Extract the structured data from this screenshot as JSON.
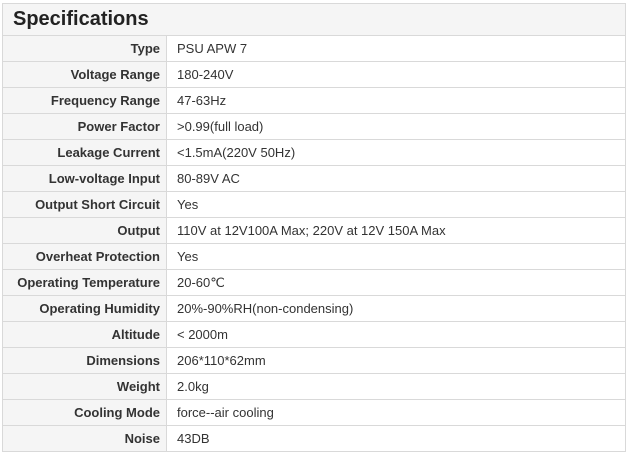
{
  "title": "Specifications",
  "rows": [
    {
      "label": "Type",
      "value": "PSU APW 7"
    },
    {
      "label": "Voltage Range",
      "value": "180-240V"
    },
    {
      "label": "Frequency Range",
      "value": "47-63Hz"
    },
    {
      "label": "Power Factor",
      "value": ">0.99(full load)"
    },
    {
      "label": "Leakage Current",
      "value": "<1.5mA(220V 50Hz)"
    },
    {
      "label": "Low-voltage Input",
      "value": "80-89V AC"
    },
    {
      "label": "Output Short Circuit",
      "value": "Yes"
    },
    {
      "label": "Output",
      "value": "110V at 12V100A Max; 220V  at 12V 150A Max"
    },
    {
      "label": "Overheat Protection",
      "value": "Yes"
    },
    {
      "label": "Operating Temperature",
      "value": "20-60℃"
    },
    {
      "label": "Operating Humidity",
      "value": "20%-90%RH(non-condensing)"
    },
    {
      "label": "Altitude",
      "value": "< 2000m"
    },
    {
      "label": "Dimensions",
      "value": "206*110*62mm"
    },
    {
      "label": "Weight",
      "value": "2.0kg"
    },
    {
      "label": "Cooling Mode",
      "value": "force--air cooling"
    },
    {
      "label": "Noise",
      "value": "43DB"
    }
  ]
}
